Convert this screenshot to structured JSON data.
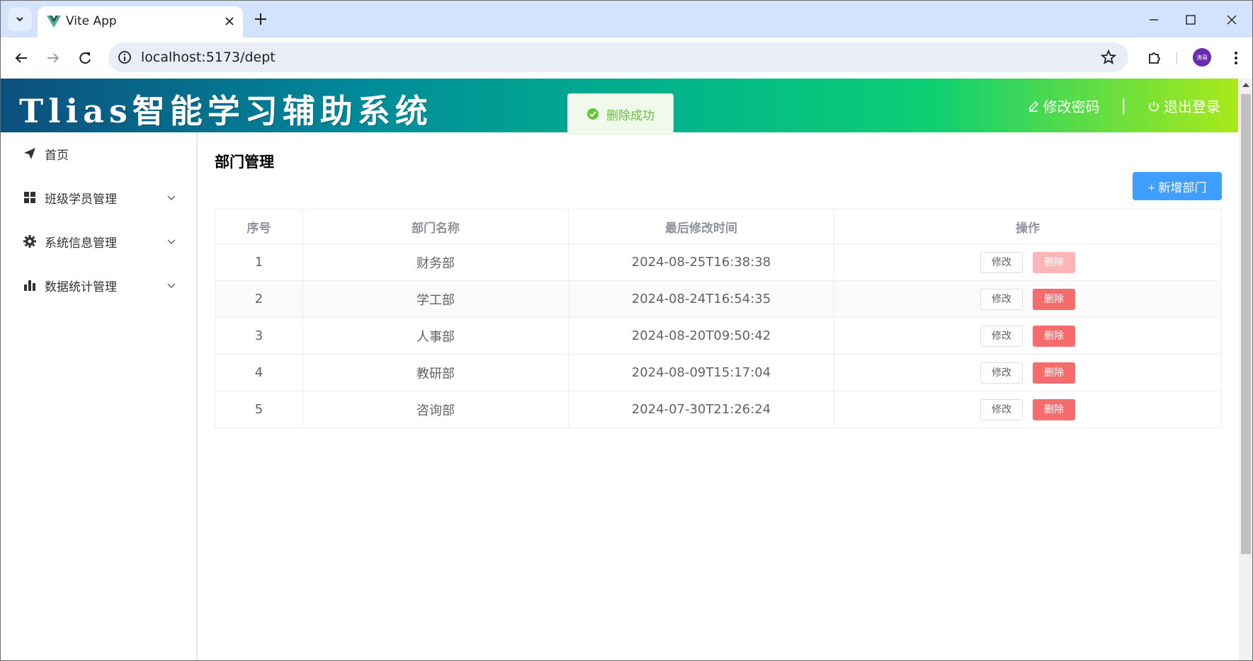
{
  "browser": {
    "tab_title": "Vite App",
    "url": "localhost:5173/dept",
    "profile_avatar_text": "涛哥"
  },
  "app": {
    "title": "Tlias智能学习辅助系统",
    "change_password": "修改密码",
    "separator": "|",
    "logout": "退出登录"
  },
  "sidebar": {
    "items": [
      {
        "label": "首页",
        "icon": "paper-plane-icon",
        "expandable": false
      },
      {
        "label": "班级学员管理",
        "icon": "grid-icon",
        "expandable": true
      },
      {
        "label": "系统信息管理",
        "icon": "gear-icon",
        "expandable": true
      },
      {
        "label": "数据统计管理",
        "icon": "bar-chart-icon",
        "expandable": true
      }
    ]
  },
  "main": {
    "page_title": "部门管理",
    "add_button": "+ 新增部门",
    "columns": [
      "序号",
      "部门名称",
      "最后修改时间",
      "操作"
    ],
    "edit_label": "修改",
    "delete_label": "删除",
    "rows": [
      {
        "index": "1",
        "name": "财务部",
        "updated": "2024-08-25T16:38:38",
        "delete_disabled": true
      },
      {
        "index": "2",
        "name": "学工部",
        "updated": "2024-08-24T16:54:35",
        "delete_disabled": false
      },
      {
        "index": "3",
        "name": "人事部",
        "updated": "2024-08-20T09:50:42",
        "delete_disabled": false
      },
      {
        "index": "4",
        "name": "教研部",
        "updated": "2024-08-09T15:17:04",
        "delete_disabled": false
      },
      {
        "index": "5",
        "name": "咨询部",
        "updated": "2024-07-30T21:26:24",
        "delete_disabled": false
      }
    ]
  },
  "toast": {
    "message": "删除成功",
    "type": "success"
  },
  "colors": {
    "primary": "#409eff",
    "danger": "#f56c6c",
    "success": "#67c23a"
  }
}
